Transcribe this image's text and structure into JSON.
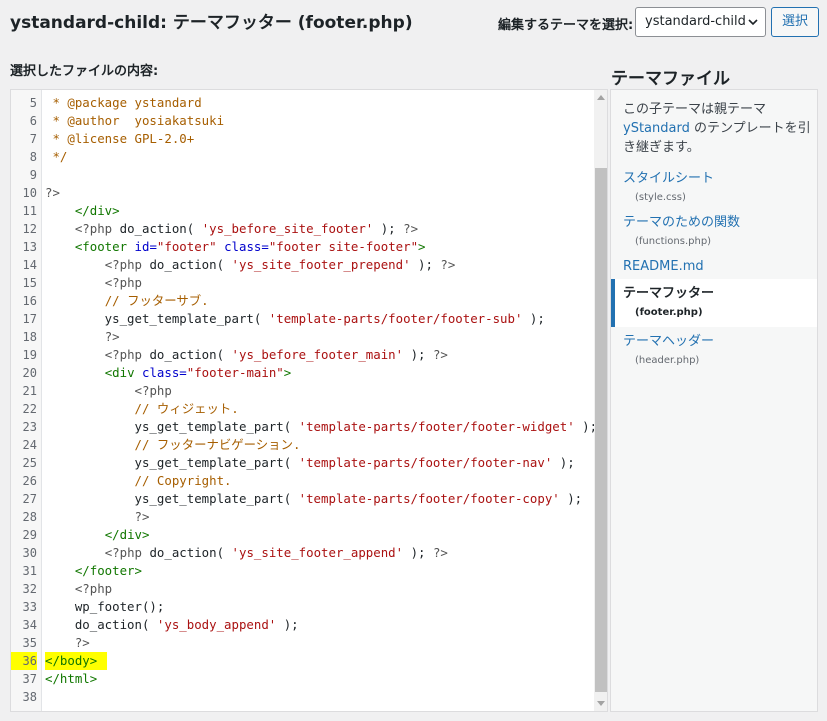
{
  "header": {
    "title": "ystandard-child: テーマフッター (footer.php)",
    "select_label": "編集するテーマを選択:",
    "theme_select_value": "ystandard-child",
    "select_button": "選択"
  },
  "editor": {
    "label": "選択したファイルの内容:",
    "highlighted_line": "36",
    "lines": [
      {
        "n": "5",
        "code": [
          [
            "c",
            " * @package ystandard"
          ]
        ]
      },
      {
        "n": "6",
        "code": [
          [
            "c",
            " * @author  yosiakatsuki"
          ]
        ]
      },
      {
        "n": "7",
        "code": [
          [
            "c",
            " * @license GPL-2.0+"
          ]
        ]
      },
      {
        "n": "8",
        "code": [
          [
            "c",
            " */"
          ]
        ]
      },
      {
        "n": "9",
        "code": []
      },
      {
        "n": "10",
        "code": [
          [
            "m",
            "?>"
          ]
        ]
      },
      {
        "n": "11",
        "code": [
          [
            "k",
            "    "
          ],
          [
            "t",
            "</div>"
          ]
        ]
      },
      {
        "n": "12",
        "code": [
          [
            "k",
            "    "
          ],
          [
            "m",
            "<?php"
          ],
          [
            "k",
            " do_action( "
          ],
          [
            "s",
            "'ys_before_site_footer'"
          ],
          [
            "k",
            " ); "
          ],
          [
            "m",
            "?>"
          ]
        ]
      },
      {
        "n": "13",
        "code": [
          [
            "k",
            "    "
          ],
          [
            "t",
            "<footer"
          ],
          [
            "k",
            " "
          ],
          [
            "a",
            "id="
          ],
          [
            "s",
            "\"footer\""
          ],
          [
            "k",
            " "
          ],
          [
            "a",
            "class="
          ],
          [
            "s",
            "\"footer site-footer\""
          ],
          [
            "t",
            ">"
          ]
        ]
      },
      {
        "n": "14",
        "code": [
          [
            "k",
            "        "
          ],
          [
            "m",
            "<?php"
          ],
          [
            "k",
            " do_action( "
          ],
          [
            "s",
            "'ys_site_footer_prepend'"
          ],
          [
            "k",
            " ); "
          ],
          [
            "m",
            "?>"
          ]
        ]
      },
      {
        "n": "15",
        "code": [
          [
            "k",
            "        "
          ],
          [
            "m",
            "<?php"
          ]
        ]
      },
      {
        "n": "16",
        "code": [
          [
            "k",
            "        "
          ],
          [
            "c",
            "// フッターサブ."
          ]
        ]
      },
      {
        "n": "17",
        "code": [
          [
            "k",
            "        ys_get_template_part( "
          ],
          [
            "s",
            "'template-parts/footer/footer-sub'"
          ],
          [
            "k",
            " );"
          ]
        ]
      },
      {
        "n": "18",
        "code": [
          [
            "k",
            "        "
          ],
          [
            "m",
            "?>"
          ]
        ]
      },
      {
        "n": "19",
        "code": [
          [
            "k",
            "        "
          ],
          [
            "m",
            "<?php"
          ],
          [
            "k",
            " do_action( "
          ],
          [
            "s",
            "'ys_before_footer_main'"
          ],
          [
            "k",
            " ); "
          ],
          [
            "m",
            "?>"
          ]
        ]
      },
      {
        "n": "20",
        "code": [
          [
            "k",
            "        "
          ],
          [
            "t",
            "<div"
          ],
          [
            "k",
            " "
          ],
          [
            "a",
            "class="
          ],
          [
            "s",
            "\"footer-main\""
          ],
          [
            "t",
            ">"
          ]
        ]
      },
      {
        "n": "21",
        "code": [
          [
            "k",
            "            "
          ],
          [
            "m",
            "<?php"
          ]
        ]
      },
      {
        "n": "22",
        "code": [
          [
            "k",
            "            "
          ],
          [
            "c",
            "// ウィジェット."
          ]
        ]
      },
      {
        "n": "23",
        "code": [
          [
            "k",
            "            ys_get_template_part( "
          ],
          [
            "s",
            "'template-parts/footer/footer-widget'"
          ],
          [
            "k",
            " );"
          ]
        ]
      },
      {
        "n": "24",
        "code": [
          [
            "k",
            "            "
          ],
          [
            "c",
            "// フッターナビゲーション."
          ]
        ]
      },
      {
        "n": "25",
        "code": [
          [
            "k",
            "            ys_get_template_part( "
          ],
          [
            "s",
            "'template-parts/footer/footer-nav'"
          ],
          [
            "k",
            " );"
          ]
        ]
      },
      {
        "n": "26",
        "code": [
          [
            "k",
            "            "
          ],
          [
            "c",
            "// Copyright."
          ]
        ]
      },
      {
        "n": "27",
        "code": [
          [
            "k",
            "            ys_get_template_part( "
          ],
          [
            "s",
            "'template-parts/footer/footer-copy'"
          ],
          [
            "k",
            " );"
          ]
        ]
      },
      {
        "n": "28",
        "code": [
          [
            "k",
            "            "
          ],
          [
            "m",
            "?>"
          ]
        ]
      },
      {
        "n": "29",
        "code": [
          [
            "k",
            "        "
          ],
          [
            "t",
            "</div>"
          ]
        ]
      },
      {
        "n": "30",
        "code": [
          [
            "k",
            "        "
          ],
          [
            "m",
            "<?php"
          ],
          [
            "k",
            " do_action( "
          ],
          [
            "s",
            "'ys_site_footer_append'"
          ],
          [
            "k",
            " ); "
          ],
          [
            "m",
            "?>"
          ]
        ]
      },
      {
        "n": "31",
        "code": [
          [
            "k",
            "    "
          ],
          [
            "t",
            "</footer>"
          ]
        ]
      },
      {
        "n": "32",
        "code": [
          [
            "k",
            "    "
          ],
          [
            "m",
            "<?php"
          ]
        ]
      },
      {
        "n": "33",
        "code": [
          [
            "k",
            "    wp_footer();"
          ]
        ]
      },
      {
        "n": "34",
        "code": [
          [
            "k",
            "    do_action( "
          ],
          [
            "s",
            "'ys_body_append'"
          ],
          [
            "k",
            " );"
          ]
        ]
      },
      {
        "n": "35",
        "code": [
          [
            "k",
            "    "
          ],
          [
            "m",
            "?>"
          ]
        ]
      },
      {
        "n": "36",
        "code": [
          [
            "t",
            "</body>"
          ]
        ]
      },
      {
        "n": "37",
        "code": [
          [
            "t",
            "</html>"
          ]
        ]
      },
      {
        "n": "38",
        "code": []
      }
    ]
  },
  "sidebar": {
    "title": "テーマファイル",
    "desc_before": "この子テーマは親テーマ",
    "desc_link": "yStandard",
    "desc_after": " のテンプレートを引き継ぎます。",
    "files": [
      {
        "name": "スタイルシート",
        "path": "(style.css)",
        "active": false
      },
      {
        "name": "テーマのための関数",
        "path": "(functions.php)",
        "active": false
      },
      {
        "name": "README.md",
        "path": "",
        "active": false
      },
      {
        "name": "テーマフッター",
        "path": "(footer.php)",
        "active": true
      },
      {
        "name": "テーマヘッダー",
        "path": "(header.php)",
        "active": false
      }
    ]
  },
  "colors": {
    "accent": "#2271b1",
    "highlight": "#ffff00",
    "comment": "#a65e00",
    "tag": "#117700",
    "attribute": "#0000cc",
    "string": "#aa1111"
  },
  "icons": {
    "select_chevron": "chevron-down-icon",
    "scroll_up": "scroll-up-arrow-icon",
    "scroll_down": "scroll-down-arrow-icon"
  }
}
